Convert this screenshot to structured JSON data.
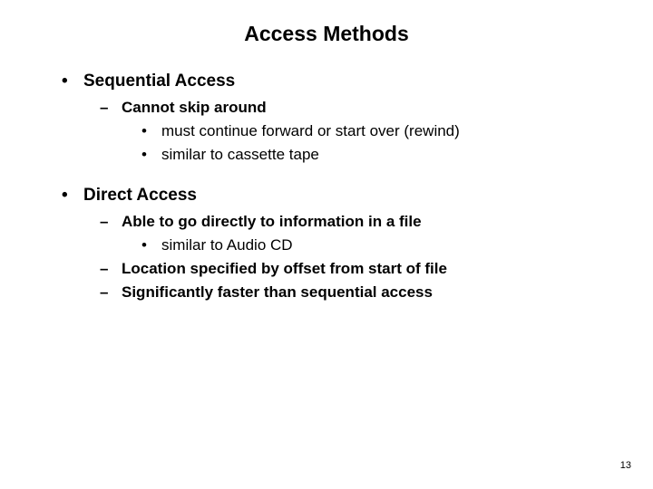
{
  "title": "Access Methods",
  "sections": [
    {
      "heading": "Sequential Access",
      "subs": [
        {
          "text": "Cannot skip around",
          "details": [
            "must continue forward or start over (rewind)",
            "similar to cassette tape"
          ]
        }
      ]
    },
    {
      "heading": "Direct Access",
      "subs": [
        {
          "text": "Able to go directly to information in a file",
          "details": [
            "similar to Audio CD"
          ]
        },
        {
          "text": "Location specified by offset from start of file",
          "details": []
        },
        {
          "text": "Significantly faster than sequential access",
          "details": []
        }
      ]
    }
  ],
  "page_number": "13"
}
